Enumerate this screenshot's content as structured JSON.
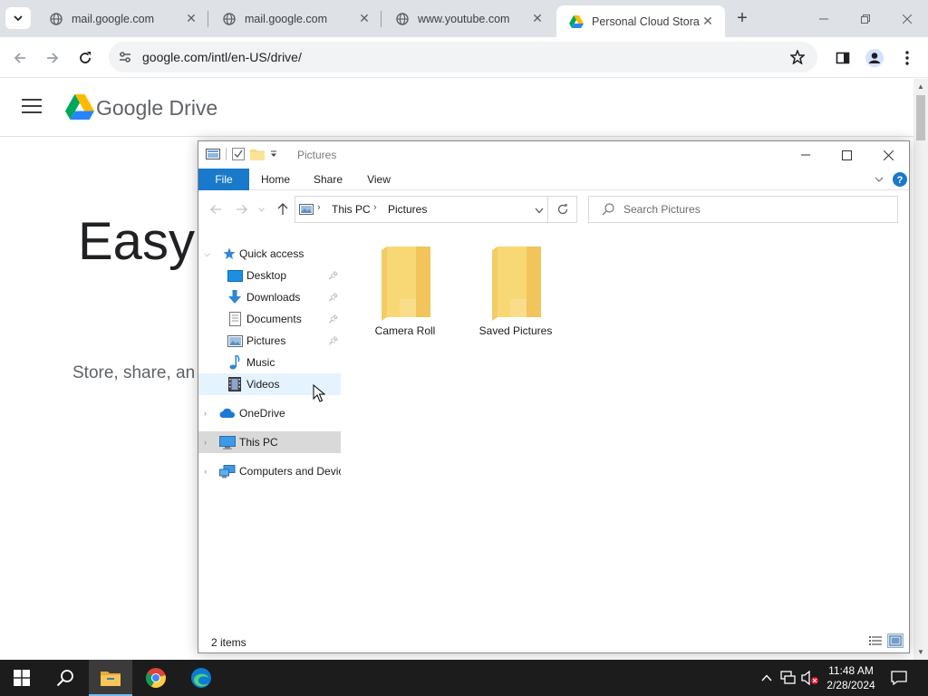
{
  "browser": {
    "tabs": [
      {
        "title": "mail.google.com",
        "favicon": "globe-icon",
        "active": false
      },
      {
        "title": "mail.google.com",
        "favicon": "globe-icon",
        "active": false
      },
      {
        "title": "www.youtube.com",
        "favicon": "globe-icon",
        "active": false
      },
      {
        "title": "Personal Cloud Storage",
        "favicon": "google-drive-icon",
        "active": true
      }
    ],
    "url": "google.com/intl/en-US/drive/"
  },
  "drive_page": {
    "brand": "Google Drive",
    "hero_text": "Easy",
    "sub_text": "Store, share, an"
  },
  "explorer": {
    "title": "Pictures",
    "ribbon_tabs": [
      "File",
      "Home",
      "Share",
      "View"
    ],
    "breadcrumb": [
      "This PC",
      "Pictures"
    ],
    "search_placeholder": "Search Pictures",
    "nav": {
      "quick_access": "Quick access",
      "quick_items": [
        {
          "label": "Desktop",
          "icon": "desktop-icon",
          "pinned": true
        },
        {
          "label": "Downloads",
          "icon": "download-arrow-icon",
          "pinned": true
        },
        {
          "label": "Documents",
          "icon": "document-icon",
          "pinned": true
        },
        {
          "label": "Pictures",
          "icon": "pictures-icon",
          "pinned": true
        },
        {
          "label": "Music",
          "icon": "music-note-icon",
          "pinned": false
        },
        {
          "label": "Videos",
          "icon": "film-icon",
          "pinned": false
        }
      ],
      "onedrive": "OneDrive",
      "this_pc": "This PC",
      "network": "Computers and Devic"
    },
    "items": [
      {
        "label": "Camera Roll",
        "icon": "folder-icon"
      },
      {
        "label": "Saved Pictures",
        "icon": "folder-icon"
      }
    ],
    "status": "2 items"
  },
  "taskbar": {
    "apps": [
      "file-explorer-icon",
      "chrome-icon",
      "edge-icon"
    ],
    "time": "11:48 AM",
    "date": "2/28/2024"
  },
  "colors": {
    "accent": "#1979ca",
    "folder": "#f8d775",
    "taskbar": "#1c1c1c"
  }
}
